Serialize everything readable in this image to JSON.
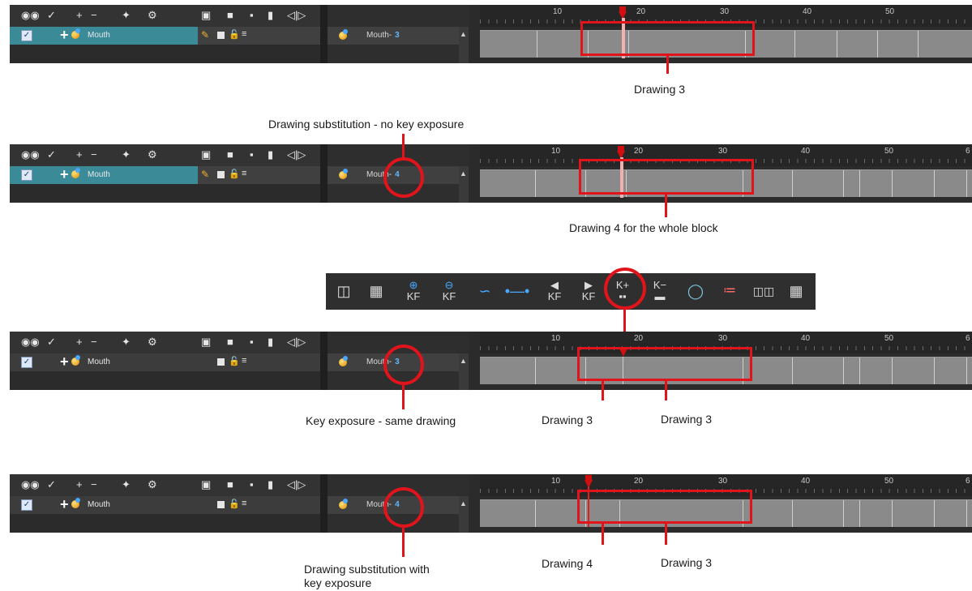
{
  "panels": [
    {
      "layer_name": "Mouth",
      "selected": true,
      "show_pencil": true,
      "cell_name": "Mouth-",
      "cell_number": "3",
      "ruler_ticks": [
        "10",
        "20",
        "30",
        "40",
        "50"
      ]
    },
    {
      "layer_name": "Mouth",
      "selected": true,
      "show_pencil": true,
      "cell_name": "Mouth-",
      "cell_number": "4",
      "ruler_ticks": [
        "10",
        "20",
        "30",
        "40",
        "50",
        "6"
      ]
    },
    {
      "layer_name": "Mouth",
      "selected": false,
      "show_pencil": false,
      "cell_name": "Mouth-",
      "cell_number": "3",
      "ruler_ticks": [
        "10",
        "20",
        "30",
        "40",
        "50",
        "6"
      ]
    },
    {
      "layer_name": "Mouth",
      "selected": false,
      "show_pencil": false,
      "cell_name": "Mouth-",
      "cell_number": "4",
      "ruler_ticks": [
        "10",
        "20",
        "30",
        "40",
        "50",
        "6"
      ]
    }
  ],
  "toolbar_icons": [
    "eyes-icon",
    "animate-check-icon",
    "add-layer-icon",
    "remove-layer-icon",
    "add-peg-icon",
    "add-drawing-icon",
    "camera-view-icon",
    "square-large-icon",
    "square-small-icon",
    "square-tall-icon",
    "expand-collapse-icon"
  ],
  "key_toolbar": {
    "buttons": [
      {
        "icon": "add-drawing-layer-icon",
        "text": ""
      },
      {
        "icon": "create-drawing-icon",
        "text": ""
      },
      {
        "icon": "add-keyframe-icon",
        "text": "KF"
      },
      {
        "icon": "remove-keyframe-icon",
        "text": "KF"
      },
      {
        "icon": "motion-curve-icon",
        "text": ""
      },
      {
        "icon": "constant-segment-icon",
        "text": ""
      },
      {
        "icon": "previous-keyframe-icon",
        "text": "KF"
      },
      {
        "icon": "next-keyframe-icon",
        "text": "KF"
      },
      {
        "icon": "add-key-exposure-icon",
        "text": "K+"
      },
      {
        "icon": "remove-key-exposure-icon",
        "text": "K−"
      },
      {
        "icon": "preview-icon",
        "text": ""
      },
      {
        "icon": "set-ease-icon",
        "text": ""
      },
      {
        "icon": "fill-empty-cell-icon",
        "text": ""
      },
      {
        "icon": "extend-exposure-icon",
        "text": ""
      }
    ]
  },
  "annotations": {
    "drawing3_top": "Drawing 3",
    "substitution_no_key": "Drawing substitution - no key exposure",
    "drawing4_whole_block": "Drawing 4 for the whole block",
    "key_exposure_same": "Key exposure - same drawing",
    "drawing3_a": "Drawing 3",
    "drawing3_b": "Drawing 3",
    "substitution_with_key_line1": "Drawing substitution with",
    "substitution_with_key_line2": "key exposure",
    "drawing4_bottom": "Drawing 4",
    "drawing3_bottom": "Drawing 3"
  }
}
